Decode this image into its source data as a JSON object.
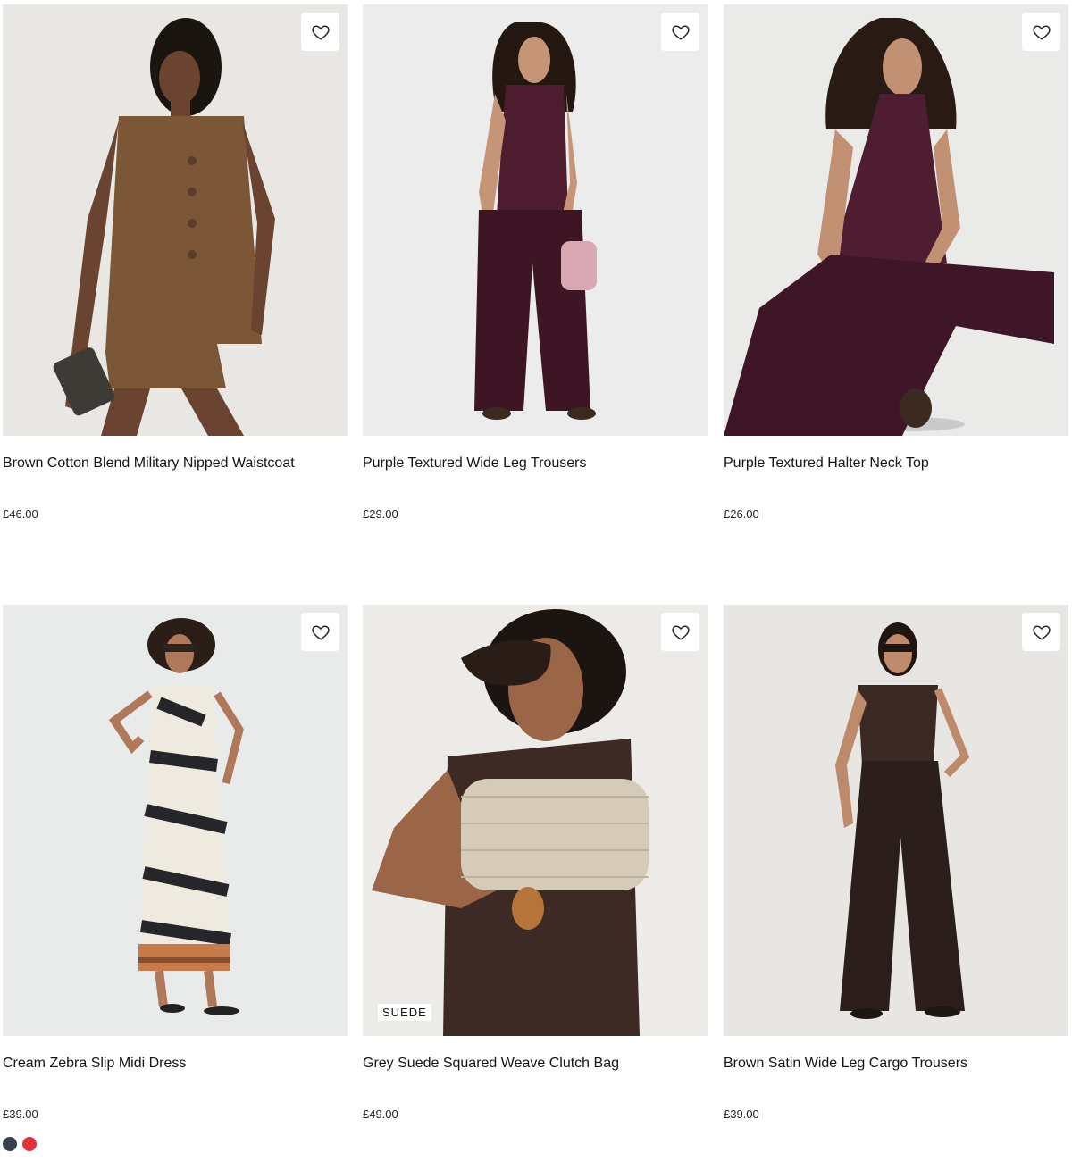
{
  "products": [
    {
      "title": "Brown Cotton Blend Military Nipped Waistcoat",
      "price": "£46.00",
      "image": {
        "background": "#e8e7e3",
        "garment": "#7b5637",
        "accent": "#5a3e27",
        "skin": "#6a4430",
        "hair": "#1b1510"
      }
    },
    {
      "title": "Purple Textured Wide Leg Trousers",
      "price": "£29.00",
      "image": {
        "background": "#ebeceb",
        "garment": "#4d1c2e",
        "accent": "#3d1524",
        "skin": "#c69577",
        "hair": "#241712"
      }
    },
    {
      "title": "Purple Textured Halter Neck Top",
      "price": "£26.00",
      "image": {
        "background": "#eaeae9",
        "garment": "#4f1d31",
        "accent": "#3f1627",
        "skin": "#c29073",
        "hair": "#2a1a14"
      }
    },
    {
      "title": "Cream Zebra Slip Midi Dress",
      "price": "£39.00",
      "swatches": [
        "#3a3f4d",
        "#e0333b"
      ],
      "image": {
        "background": "#e9eaea",
        "garment": "#efeae0",
        "accent": "#26252a",
        "skin": "#b0785a",
        "hair": "#2b1e16"
      }
    },
    {
      "title": "Grey Suede Squared Weave Clutch Bag",
      "price": "£49.00",
      "badge": "SUEDE",
      "image": {
        "background": "#ecebe7",
        "garment": "#3d2a24",
        "accent": "#d5cbb8",
        "skin": "#9a6647",
        "hair": "#1b1410"
      }
    },
    {
      "title": "Brown Satin Wide Leg Cargo Trousers",
      "price": "£39.00",
      "image": {
        "background": "#e7e6e3",
        "garment": "#3a2823",
        "accent": "#2c1f1b",
        "skin": "#bd8a6c",
        "hair": "#21160f"
      }
    }
  ],
  "icons": {
    "favourite": "heart-outline-icon"
  }
}
